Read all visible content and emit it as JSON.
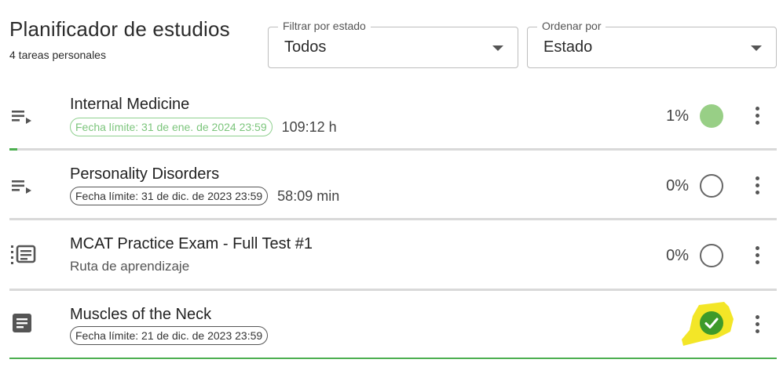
{
  "header": {
    "title": "Planificador de estudios",
    "subtitle": "4 tareas personales"
  },
  "filters": {
    "status": {
      "label": "Filtrar por estado",
      "value": "Todos"
    },
    "sort": {
      "label": "Ordenar por",
      "value": "Estado"
    }
  },
  "tasks": [
    {
      "title": "Internal Medicine",
      "deadline": "Fecha límite: 31 de ene. de 2024 23:59",
      "duration": "109:12 h",
      "percent": "1%",
      "progress": 0.01,
      "status": "in-progress",
      "type_icon": "playlist-play-icon"
    },
    {
      "title": "Personality Disorders",
      "deadline": "Fecha límite: 31 de dic. de 2023 23:59",
      "duration": "58:09 min",
      "percent": "0%",
      "progress": 0,
      "status": "not-started",
      "type_icon": "playlist-play-icon"
    },
    {
      "title": "MCAT Practice Exam - Full Test #1",
      "subtitle": "Ruta de aprendizaje",
      "percent": "0%",
      "progress": 0,
      "status": "not-started",
      "type_icon": "learning-path-icon"
    },
    {
      "title": "Muscles of the Neck",
      "deadline": "Fecha límite: 21 de dic. de 2023 23:59",
      "progress": 1,
      "status": "completed",
      "type_icon": "article-icon"
    }
  ],
  "colors": {
    "accent_green": "#4caf50",
    "overdue_green": "#7cc57c",
    "completed_green": "#3e9a2a",
    "highlight_yellow": "#f2e51b"
  }
}
